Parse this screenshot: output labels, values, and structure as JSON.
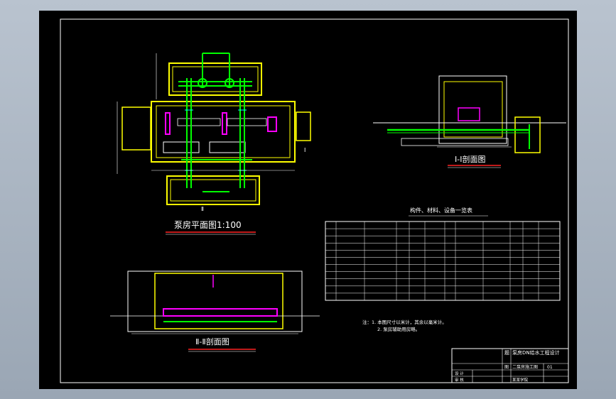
{
  "drawing": {
    "plan_title": "泵房平面图1:100",
    "plan_title_pre": "泵房平面图",
    "plan_title_scale": "1:100",
    "section1_title": "Ⅰ-Ⅰ剖面图",
    "section1_mark": "Ⅰ-Ⅰ",
    "section1_word": "剖面图",
    "section2_title": "Ⅱ-Ⅱ剖面图",
    "section2_mark": "Ⅱ-Ⅱ",
    "section2_word": "剖面图",
    "table_title": "构件、材料、设备一览表",
    "notes": [
      "注：1. 本图尺寸以米计，其余以毫米计。",
      "2. 泵房辅助用房略。"
    ],
    "title_block": {
      "project_label": "题",
      "project": "泵房DN给水工程设计",
      "drawing_label": "图",
      "drawing": "二泵房施工图",
      "sheet_no": "01",
      "row_labels": [
        "设 计",
        "审 核"
      ],
      "school": "某某学院"
    },
    "colors": {
      "background": "#000000",
      "frame": "#ffffff",
      "walls": "#ffff00",
      "pipes": "#00ff00",
      "equipment": "#ff00ff",
      "title_underline": "#ff2020"
    }
  }
}
